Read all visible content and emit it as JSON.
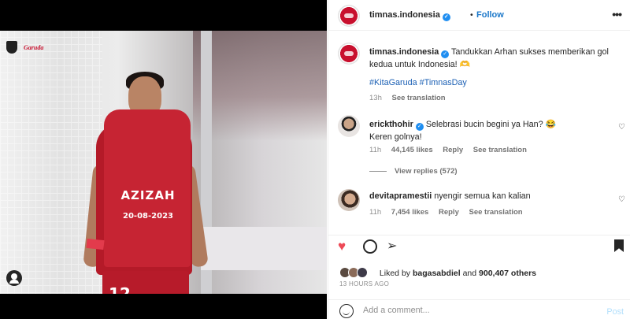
{
  "post": {
    "photo": {
      "shirt_name": "AZIZAH",
      "shirt_date": "20-08-2023",
      "shorts_number": "12",
      "logo_text": "Garuda"
    },
    "header": {
      "username": "timnas.indonesia",
      "dot": "•",
      "follow_label": "Follow",
      "more_icon": "more-icon"
    },
    "caption": {
      "username": "timnas.indonesia",
      "text": "Tandukkan Arhan sukses memberikan gol kedua untuk Indonesia! 🫶",
      "hashtags": "#KitaGaruda #TimnasDay",
      "time": "13h",
      "see_translation": "See translation"
    },
    "comments": [
      {
        "username": "erickthohir",
        "text": "Selebrasi bucin begini ya Han? 😂",
        "text2": "Keren golnya!",
        "time": "11h",
        "likes": "44,145 likes",
        "reply": "Reply",
        "see_translation": "See translation",
        "view_replies": "View replies (572)"
      },
      {
        "username": "devitapramestii",
        "text": "nyengir semua kan kalian",
        "time": "11h",
        "likes": "7,454 likes",
        "reply": "Reply",
        "see_translation": "See translation"
      }
    ],
    "likes": {
      "prefix": "Liked by",
      "user": "bagasabdiel",
      "and": "and",
      "others": "900,407 others"
    },
    "timestamp": "13 HOURS AGO",
    "add_comment": {
      "placeholder": "Add a comment...",
      "post_label": "Post"
    }
  },
  "colors": {
    "accent": "#1a77c9",
    "like_red": "#ed4956",
    "verified": "#1f8ef1",
    "jersey": "#c62433"
  }
}
